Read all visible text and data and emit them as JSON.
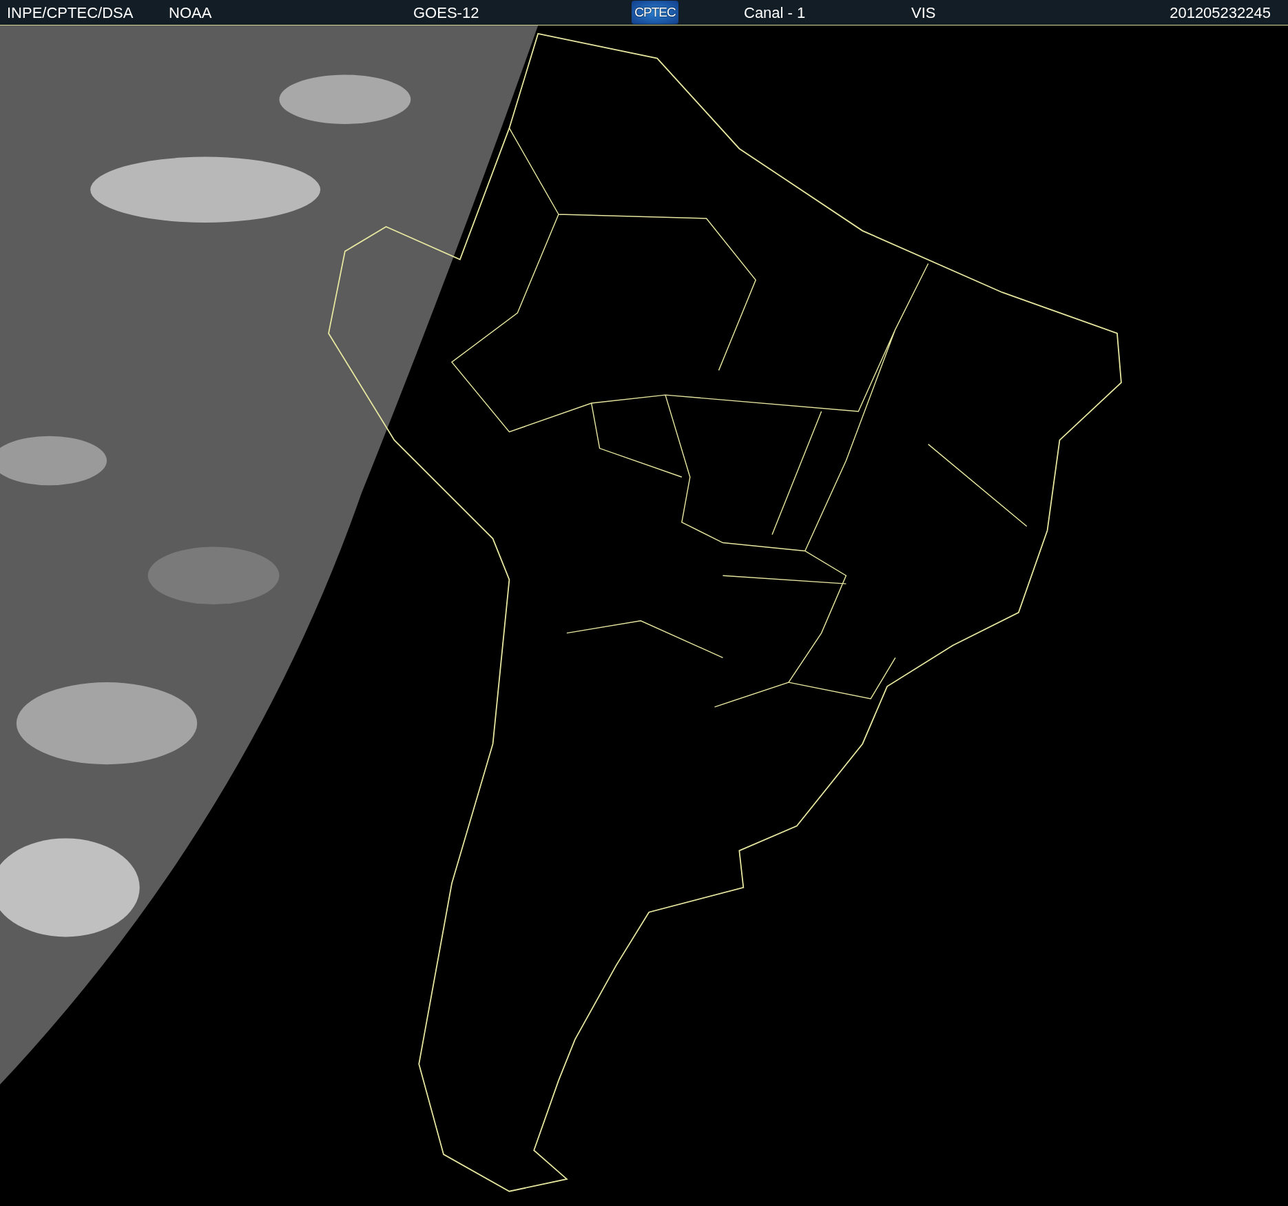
{
  "header": {
    "items": [
      {
        "kind": "text",
        "text": "INPE/CPTEC/DSA"
      },
      {
        "kind": "text",
        "text": "NOAA"
      },
      {
        "kind": "text",
        "text": "GOES-12"
      },
      {
        "kind": "logo",
        "text": "CPTEC"
      },
      {
        "kind": "text",
        "text": "Canal - 1"
      },
      {
        "kind": "text",
        "text": "VIS"
      },
      {
        "kind": "timestamp",
        "text": "201205232245"
      }
    ]
  }
}
